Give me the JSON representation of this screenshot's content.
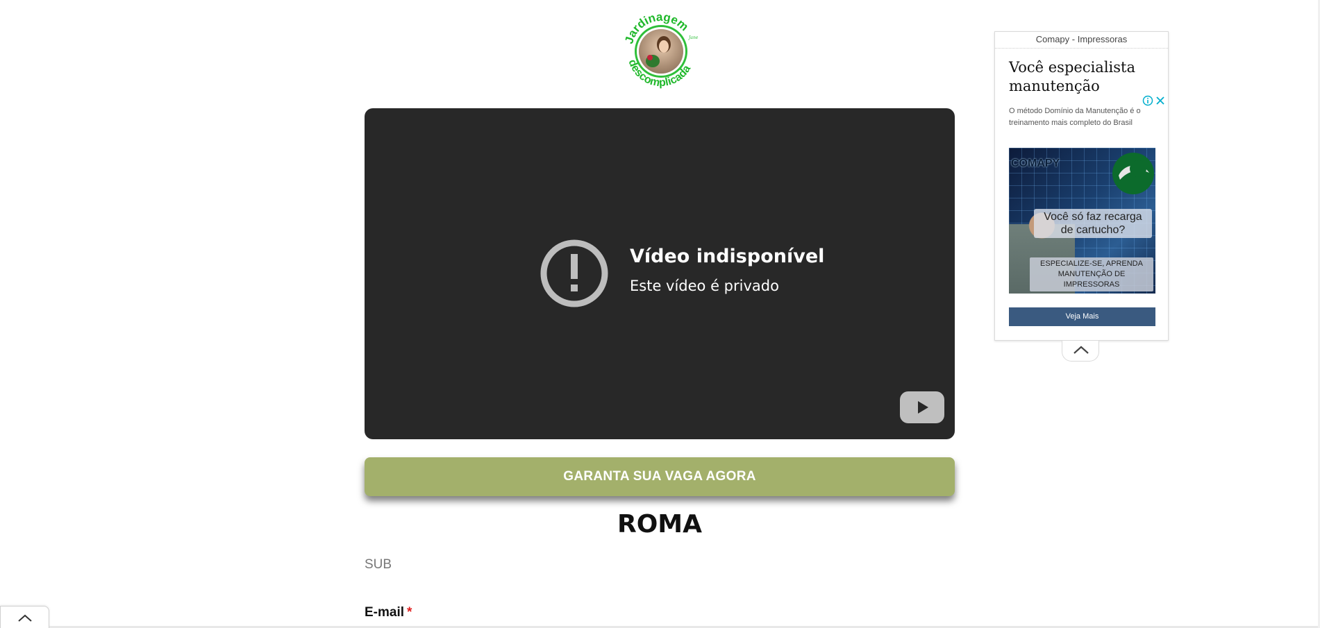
{
  "logo": {
    "text_top": "Jardinagem",
    "text_bottom": "descomplicada",
    "mark": "Jane"
  },
  "video": {
    "title": "Vídeo indisponível",
    "subtitle": "Este vídeo é privado",
    "icon": "exclamation-icon",
    "logo_icon": "youtube-icon",
    "background": "#282828"
  },
  "cta": {
    "label": "GARANTA SUA VAGA AGORA",
    "color": "#a3b06b"
  },
  "heading": "ROMA",
  "sub": "SUB",
  "email": {
    "label": "E-mail",
    "required_mark": "*"
  },
  "ad": {
    "sponsor": "Comapy - Impressoras",
    "headline": "Você especialista manutenção",
    "body": "O método Domínio da Manutenção é o treinamento mais completo do Brasil",
    "image": {
      "brand": "COMAPY",
      "question": "Você só faz recarga de cartucho?",
      "banner": "ESPECIALIZE-SE, APRENDA MANUTENÇÃO DE IMPRESSORAS"
    },
    "button": "Veja Mais",
    "button_color": "#3a5a80",
    "info_icon": "info-icon",
    "close_icon": "close-icon"
  },
  "collapse_icon": "chevron-up-icon"
}
